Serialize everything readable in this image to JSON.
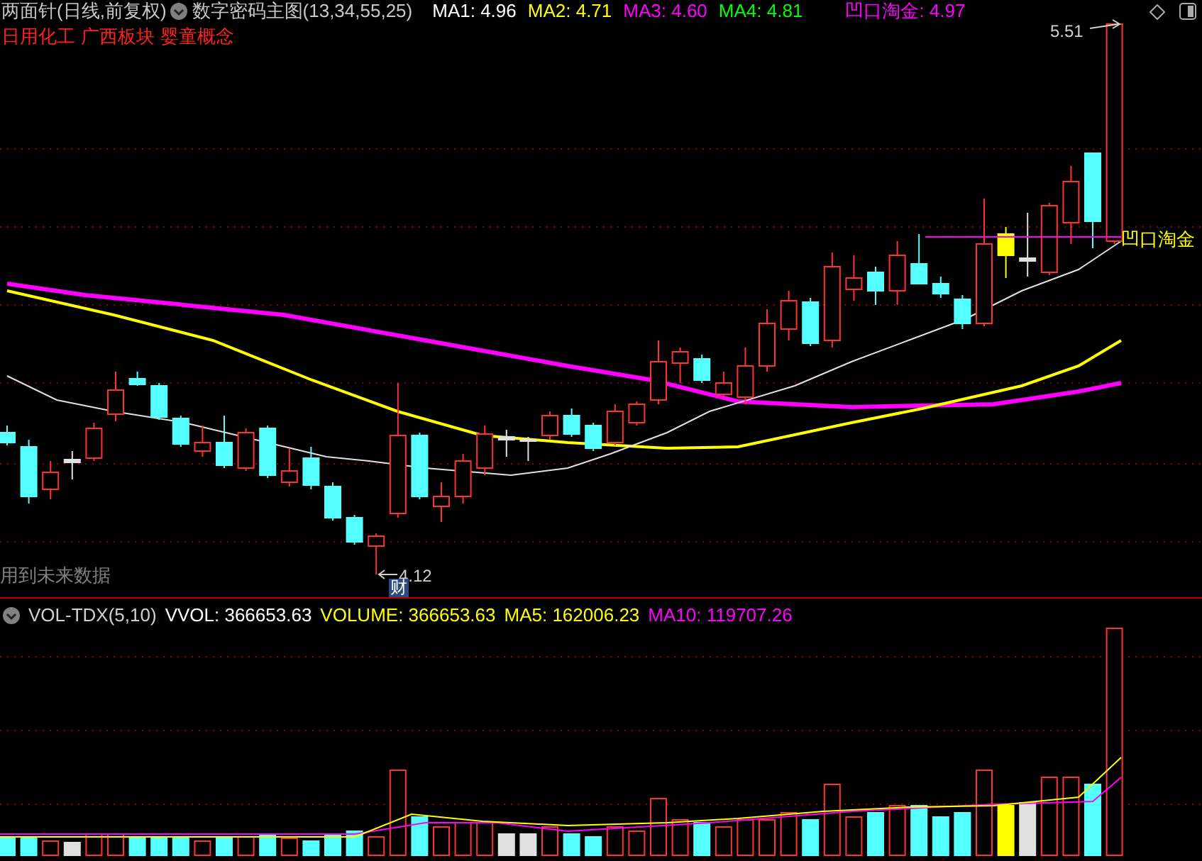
{
  "header": {
    "title": "两面针(日线,前复权)",
    "indicator": "数字密码主图(13,34,55,25)",
    "readings": [
      {
        "text": "MA1: 4.96",
        "color": "#ffffff"
      },
      {
        "text": "MA2: 4.71",
        "color": "#ffff00"
      },
      {
        "text": "MA3: 4.60",
        "color": "#ff00ff"
      },
      {
        "text": "MA4: 4.81",
        "color": "#00ff00"
      }
    ],
    "signal": {
      "text": "凹口淘金: 4.97",
      "color": "#ff00ff"
    }
  },
  "tags": [
    "日用化工",
    "广西板块",
    "婴童概念"
  ],
  "price_chart": {
    "high_label": "5.51",
    "low_label": "4.12",
    "low_badge": "财",
    "signal_label": "凹口淘金",
    "note": "用到未来数据"
  },
  "volume": {
    "indicator": "VOL-TDX(5,10)",
    "readings": [
      {
        "text": "VVOL: 366653.63",
        "color": "#ffffff"
      },
      {
        "text": "VOLUME: 366653.63",
        "color": "#ffff00"
      },
      {
        "text": "MA5: 162006.23",
        "color": "#ffff00"
      },
      {
        "text": "MA10: 119707.26",
        "color": "#ff00ff"
      }
    ]
  }
}
